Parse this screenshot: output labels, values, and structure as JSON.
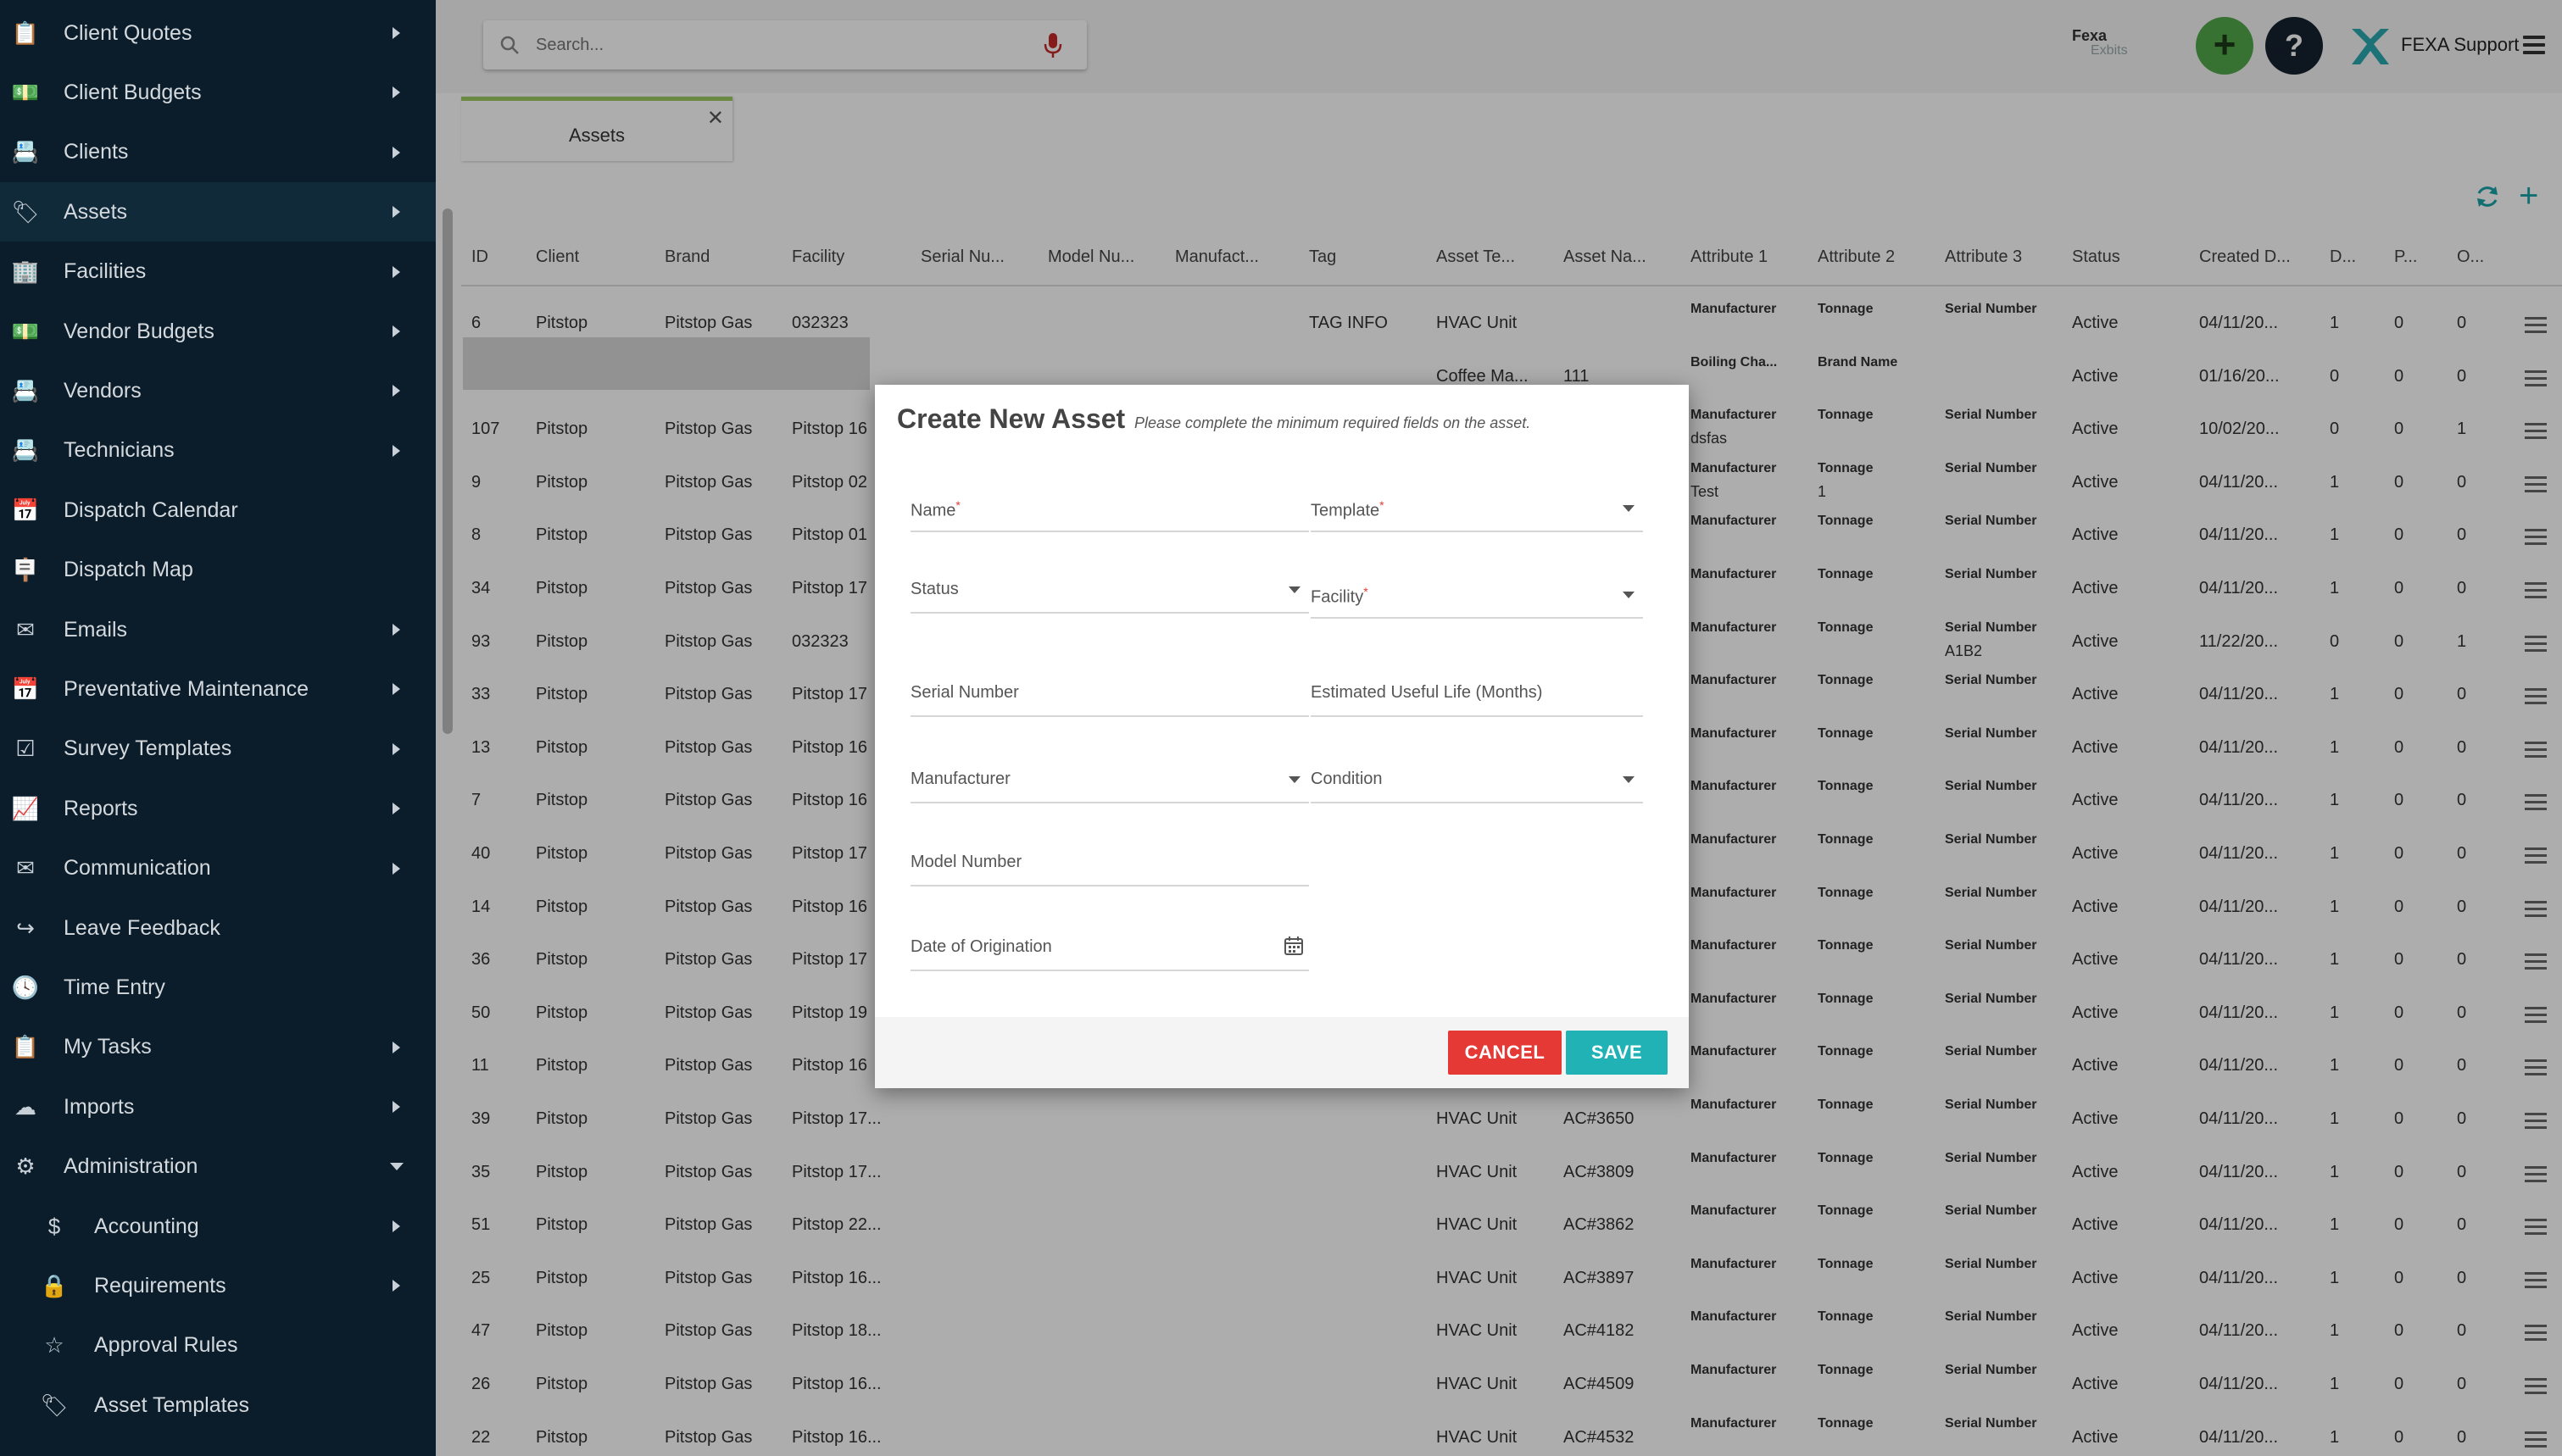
{
  "sidebar": {
    "items": [
      {
        "label": "Client Quotes",
        "icon": "clipboard-icon",
        "glyph": "📋",
        "caret": "right"
      },
      {
        "label": "Client Budgets",
        "icon": "money-icon",
        "glyph": "💵",
        "caret": "right"
      },
      {
        "label": "Clients",
        "icon": "contact-card-icon",
        "glyph": "📇",
        "caret": "right"
      },
      {
        "label": "Assets",
        "icon": "tags-icon",
        "glyph": "🏷",
        "caret": "right",
        "active": true
      },
      {
        "label": "Facilities",
        "icon": "building-icon",
        "glyph": "🏢",
        "caret": "right"
      },
      {
        "label": "Vendor Budgets",
        "icon": "money-icon",
        "glyph": "💵",
        "caret": "right"
      },
      {
        "label": "Vendors",
        "icon": "contact-card-icon",
        "glyph": "📇",
        "caret": "right"
      },
      {
        "label": "Technicians",
        "icon": "contact-card-icon",
        "glyph": "📇",
        "caret": "right"
      },
      {
        "label": "Dispatch Calendar",
        "icon": "calendar-icon",
        "glyph": "📅",
        "caret": ""
      },
      {
        "label": "Dispatch Map",
        "icon": "signpost-icon",
        "glyph": "🪧",
        "caret": ""
      },
      {
        "label": "Emails",
        "icon": "envelope-open-icon",
        "glyph": "✉",
        "caret": "right"
      },
      {
        "label": "Preventative Maintenance",
        "icon": "calendar-icon",
        "glyph": "📅",
        "caret": "right"
      },
      {
        "label": "Survey Templates",
        "icon": "checkbox-icon",
        "glyph": "☑",
        "caret": "right"
      },
      {
        "label": "Reports",
        "icon": "line-chart-icon",
        "glyph": "📈",
        "caret": "right"
      },
      {
        "label": "Communication",
        "icon": "envelope-icon",
        "glyph": "✉",
        "caret": "right"
      },
      {
        "label": "Leave Feedback",
        "icon": "share-icon",
        "glyph": "↪",
        "caret": ""
      },
      {
        "label": "Time Entry",
        "icon": "clock-icon",
        "glyph": "🕓",
        "caret": ""
      },
      {
        "label": "My Tasks",
        "icon": "clipboard-icon",
        "glyph": "📋",
        "caret": "right"
      },
      {
        "label": "Imports",
        "icon": "cloud-upload-icon",
        "glyph": "☁",
        "caret": "right"
      },
      {
        "label": "Administration",
        "icon": "cogs-icon",
        "glyph": "⚙",
        "caret": "down"
      },
      {
        "label": "Accounting",
        "icon": "dollar-icon",
        "glyph": "$",
        "caret": "right",
        "sub": true
      },
      {
        "label": "Requirements",
        "icon": "lock-icon",
        "glyph": "🔒",
        "caret": "right",
        "sub": true
      },
      {
        "label": "Approval Rules",
        "icon": "star-half-icon",
        "glyph": "☆",
        "caret": "",
        "sub": true
      },
      {
        "label": "Asset Templates",
        "icon": "tags-icon",
        "glyph": "🏷",
        "caret": "",
        "sub": true
      }
    ]
  },
  "header": {
    "search_placeholder": "Search...",
    "logo_text": "Fexa",
    "logo_sub": "Exbits",
    "add_label": "+",
    "help_label": "?",
    "user_name": "FEXA Support"
  },
  "tab": {
    "label": "Assets",
    "close": "✕"
  },
  "table": {
    "headers": [
      "ID",
      "Client",
      "Brand",
      "Facility",
      "Serial Nu...",
      "Model Nu...",
      "Manufact...",
      "Tag",
      "Asset Te...",
      "Asset Na...",
      "Attribute 1",
      "Attribute 2",
      "Attribute 3",
      "Status",
      "Created D...",
      "D...",
      "P...",
      "O..."
    ],
    "rows": [
      {
        "id": "6",
        "client": "Pitstop",
        "brand": "Pitstop Gas",
        "facility": "032323",
        "tag": "TAG INFO",
        "asset_type": "HVAC Unit",
        "asset_name": "",
        "a1": "Manufacturer",
        "a1b": "",
        "a2": "Tonnage",
        "a2b": "",
        "a3": "Serial Number",
        "a3b": "",
        "status": "Active",
        "created": "04/11/20...",
        "d": "1",
        "p": "0",
        "o": "0"
      },
      {
        "id": "",
        "client": "",
        "brand": "",
        "facility": "",
        "tag": "",
        "asset_type": "Coffee Ma...",
        "asset_name": "111",
        "a1": "Boiling Cha...",
        "a1b": "",
        "a2": "Brand Name",
        "a2b": "",
        "a3": "",
        "a3b": "",
        "status": "Active",
        "created": "01/16/20...",
        "d": "0",
        "p": "0",
        "o": "0"
      },
      {
        "id": "107",
        "client": "Pitstop",
        "brand": "Pitstop Gas",
        "facility": "Pitstop 16",
        "tag": "",
        "asset_type": "",
        "asset_name": "",
        "a1": "Manufacturer",
        "a1b": "dsfas",
        "a2": "Tonnage",
        "a2b": "",
        "a3": "Serial Number",
        "a3b": "",
        "status": "Active",
        "created": "10/02/20...",
        "d": "0",
        "p": "0",
        "o": "1"
      },
      {
        "id": "9",
        "client": "Pitstop",
        "brand": "Pitstop Gas",
        "facility": "Pitstop 02",
        "tag": "",
        "asset_type": "",
        "asset_name": "",
        "a1": "Manufacturer",
        "a1b": "Test",
        "a2": "Tonnage",
        "a2b": "1",
        "a3": "Serial Number",
        "a3b": "",
        "status": "Active",
        "created": "04/11/20...",
        "d": "1",
        "p": "0",
        "o": "0"
      },
      {
        "id": "8",
        "client": "Pitstop",
        "brand": "Pitstop Gas",
        "facility": "Pitstop 01",
        "tag": "",
        "asset_type": "",
        "asset_name": "",
        "a1": "Manufacturer",
        "a1b": "",
        "a2": "Tonnage",
        "a2b": "",
        "a3": "Serial Number",
        "a3b": "",
        "status": "Active",
        "created": "04/11/20...",
        "d": "1",
        "p": "0",
        "o": "0"
      },
      {
        "id": "34",
        "client": "Pitstop",
        "brand": "Pitstop Gas",
        "facility": "Pitstop 17",
        "tag": "",
        "asset_type": "",
        "asset_name": "",
        "a1": "Manufacturer",
        "a1b": "",
        "a2": "Tonnage",
        "a2b": "",
        "a3": "Serial Number",
        "a3b": "",
        "status": "Active",
        "created": "04/11/20...",
        "d": "1",
        "p": "0",
        "o": "0"
      },
      {
        "id": "93",
        "client": "Pitstop",
        "brand": "Pitstop Gas",
        "facility": "032323",
        "tag": "",
        "asset_type": "",
        "asset_name": "",
        "a1": "Manufacturer",
        "a1b": "",
        "a2": "Tonnage",
        "a2b": "",
        "a3": "Serial Number",
        "a3b": "A1B2",
        "status": "Active",
        "created": "11/22/20...",
        "d": "0",
        "p": "0",
        "o": "1"
      },
      {
        "id": "33",
        "client": "Pitstop",
        "brand": "Pitstop Gas",
        "facility": "Pitstop 17",
        "tag": "",
        "asset_type": "",
        "asset_name": "",
        "a1": "Manufacturer",
        "a1b": "",
        "a2": "Tonnage",
        "a2b": "",
        "a3": "Serial Number",
        "a3b": "",
        "status": "Active",
        "created": "04/11/20...",
        "d": "1",
        "p": "0",
        "o": "0"
      },
      {
        "id": "13",
        "client": "Pitstop",
        "brand": "Pitstop Gas",
        "facility": "Pitstop 16",
        "tag": "",
        "asset_type": "",
        "asset_name": "",
        "a1": "Manufacturer",
        "a1b": "",
        "a2": "Tonnage",
        "a2b": "",
        "a3": "Serial Number",
        "a3b": "",
        "status": "Active",
        "created": "04/11/20...",
        "d": "1",
        "p": "0",
        "o": "0"
      },
      {
        "id": "7",
        "client": "Pitstop",
        "brand": "Pitstop Gas",
        "facility": "Pitstop 16",
        "tag": "",
        "asset_type": "",
        "asset_name": "",
        "a1": "Manufacturer",
        "a1b": "",
        "a2": "Tonnage",
        "a2b": "",
        "a3": "Serial Number",
        "a3b": "",
        "status": "Active",
        "created": "04/11/20...",
        "d": "1",
        "p": "0",
        "o": "0"
      },
      {
        "id": "40",
        "client": "Pitstop",
        "brand": "Pitstop Gas",
        "facility": "Pitstop 17",
        "tag": "",
        "asset_type": "",
        "asset_name": "",
        "a1": "Manufacturer",
        "a1b": "",
        "a2": "Tonnage",
        "a2b": "",
        "a3": "Serial Number",
        "a3b": "",
        "status": "Active",
        "created": "04/11/20...",
        "d": "1",
        "p": "0",
        "o": "0"
      },
      {
        "id": "14",
        "client": "Pitstop",
        "brand": "Pitstop Gas",
        "facility": "Pitstop 16",
        "tag": "",
        "asset_type": "",
        "asset_name": "",
        "a1": "Manufacturer",
        "a1b": "",
        "a2": "Tonnage",
        "a2b": "",
        "a3": "Serial Number",
        "a3b": "",
        "status": "Active",
        "created": "04/11/20...",
        "d": "1",
        "p": "0",
        "o": "0"
      },
      {
        "id": "36",
        "client": "Pitstop",
        "brand": "Pitstop Gas",
        "facility": "Pitstop 17",
        "tag": "",
        "asset_type": "",
        "asset_name": "",
        "a1": "Manufacturer",
        "a1b": "",
        "a2": "Tonnage",
        "a2b": "",
        "a3": "Serial Number",
        "a3b": "",
        "status": "Active",
        "created": "04/11/20...",
        "d": "1",
        "p": "0",
        "o": "0"
      },
      {
        "id": "50",
        "client": "Pitstop",
        "brand": "Pitstop Gas",
        "facility": "Pitstop 19",
        "tag": "",
        "asset_type": "",
        "asset_name": "",
        "a1": "Manufacturer",
        "a1b": "",
        "a2": "Tonnage",
        "a2b": "",
        "a3": "Serial Number",
        "a3b": "",
        "status": "Active",
        "created": "04/11/20...",
        "d": "1",
        "p": "0",
        "o": "0"
      },
      {
        "id": "11",
        "client": "Pitstop",
        "brand": "Pitstop Gas",
        "facility": "Pitstop 16",
        "tag": "",
        "asset_type": "",
        "asset_name": "",
        "a1": "Manufacturer",
        "a1b": "",
        "a2": "Tonnage",
        "a2b": "",
        "a3": "Serial Number",
        "a3b": "",
        "status": "Active",
        "created": "04/11/20...",
        "d": "1",
        "p": "0",
        "o": "0"
      },
      {
        "id": "39",
        "client": "Pitstop",
        "brand": "Pitstop Gas",
        "facility": "Pitstop 17...",
        "tag": "",
        "asset_type": "HVAC Unit",
        "asset_name": "AC#3650",
        "a1": "Manufacturer",
        "a1b": "",
        "a2": "Tonnage",
        "a2b": "",
        "a3": "Serial Number",
        "a3b": "",
        "status": "Active",
        "created": "04/11/20...",
        "d": "1",
        "p": "0",
        "o": "0"
      },
      {
        "id": "35",
        "client": "Pitstop",
        "brand": "Pitstop Gas",
        "facility": "Pitstop 17...",
        "tag": "",
        "asset_type": "HVAC Unit",
        "asset_name": "AC#3809",
        "a1": "Manufacturer",
        "a1b": "",
        "a2": "Tonnage",
        "a2b": "",
        "a3": "Serial Number",
        "a3b": "",
        "status": "Active",
        "created": "04/11/20...",
        "d": "1",
        "p": "0",
        "o": "0"
      },
      {
        "id": "51",
        "client": "Pitstop",
        "brand": "Pitstop Gas",
        "facility": "Pitstop 22...",
        "tag": "",
        "asset_type": "HVAC Unit",
        "asset_name": "AC#3862",
        "a1": "Manufacturer",
        "a1b": "",
        "a2": "Tonnage",
        "a2b": "",
        "a3": "Serial Number",
        "a3b": "",
        "status": "Active",
        "created": "04/11/20...",
        "d": "1",
        "p": "0",
        "o": "0"
      },
      {
        "id": "25",
        "client": "Pitstop",
        "brand": "Pitstop Gas",
        "facility": "Pitstop 16...",
        "tag": "",
        "asset_type": "HVAC Unit",
        "asset_name": "AC#3897",
        "a1": "Manufacturer",
        "a1b": "",
        "a2": "Tonnage",
        "a2b": "",
        "a3": "Serial Number",
        "a3b": "",
        "status": "Active",
        "created": "04/11/20...",
        "d": "1",
        "p": "0",
        "o": "0"
      },
      {
        "id": "47",
        "client": "Pitstop",
        "brand": "Pitstop Gas",
        "facility": "Pitstop 18...",
        "tag": "",
        "asset_type": "HVAC Unit",
        "asset_name": "AC#4182",
        "a1": "Manufacturer",
        "a1b": "",
        "a2": "Tonnage",
        "a2b": "",
        "a3": "Serial Number",
        "a3b": "",
        "status": "Active",
        "created": "04/11/20...",
        "d": "1",
        "p": "0",
        "o": "0"
      },
      {
        "id": "26",
        "client": "Pitstop",
        "brand": "Pitstop Gas",
        "facility": "Pitstop 16...",
        "tag": "",
        "asset_type": "HVAC Unit",
        "asset_name": "AC#4509",
        "a1": "Manufacturer",
        "a1b": "",
        "a2": "Tonnage",
        "a2b": "",
        "a3": "Serial Number",
        "a3b": "",
        "status": "Active",
        "created": "04/11/20...",
        "d": "1",
        "p": "0",
        "o": "0"
      },
      {
        "id": "22",
        "client": "Pitstop",
        "brand": "Pitstop Gas",
        "facility": "Pitstop 16...",
        "tag": "",
        "asset_type": "HVAC Unit",
        "asset_name": "AC#4532",
        "a1": "Manufacturer",
        "a1b": "",
        "a2": "Tonnage",
        "a2b": "",
        "a3": "Serial Number",
        "a3b": "",
        "status": "Active",
        "created": "04/11/20...",
        "d": "1",
        "p": "0",
        "o": "0"
      }
    ]
  },
  "modal": {
    "title": "Create New Asset",
    "subtitle": "Please complete the minimum required fields on the asset.",
    "fields": {
      "name": {
        "label": "Name",
        "required": "*"
      },
      "template": {
        "label": "Template",
        "required": "*"
      },
      "status": {
        "label": "Status"
      },
      "facility": {
        "label": "Facility",
        "required": "*"
      },
      "serial_number": {
        "label": "Serial Number"
      },
      "useful_life": {
        "label": "Estimated Useful Life (Months)"
      },
      "manufacturer": {
        "label": "Manufacturer"
      },
      "condition": {
        "label": "Condition"
      },
      "model_number": {
        "label": "Model Number"
      },
      "origination_date": {
        "label": "Date of Origination"
      }
    },
    "cancel_label": "CANCEL",
    "save_label": "SAVE"
  },
  "colors": {
    "sidebar_bg": "#0b1d2a",
    "accent_teal": "#20b2b5",
    "cancel_red": "#e53935",
    "add_green": "#52a84a",
    "tab_green": "#9ccc65"
  }
}
